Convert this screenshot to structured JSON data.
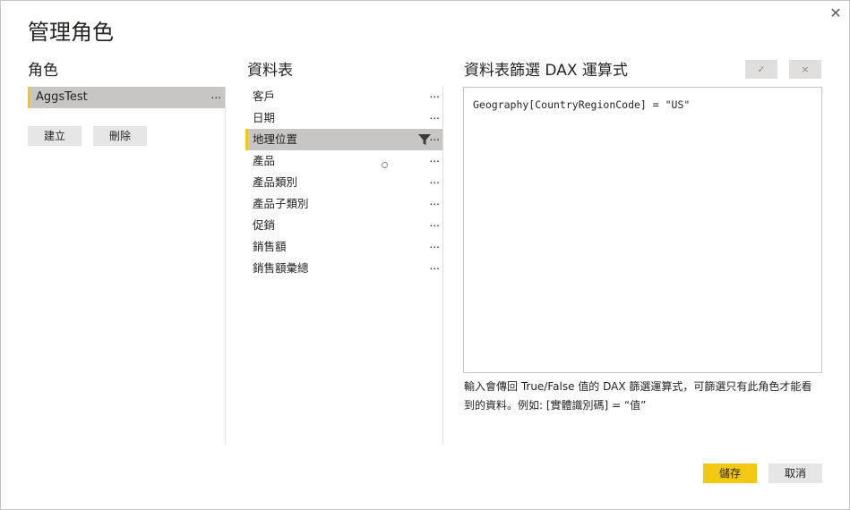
{
  "dialog": {
    "title": "管理角色",
    "close_glyph": "✕"
  },
  "roles": {
    "heading": "角色",
    "items": [
      {
        "name": "AggsTest",
        "more": "..."
      }
    ],
    "create_label": "建立",
    "delete_label": "刪除"
  },
  "tables": {
    "heading": "資料表",
    "items": [
      {
        "name": "客戶",
        "more": "..."
      },
      {
        "name": "日期",
        "more": "..."
      },
      {
        "name": "地理位置",
        "more": "...",
        "selected": true
      },
      {
        "name": "產品",
        "more": "..."
      },
      {
        "name": "產品類別",
        "more": "..."
      },
      {
        "name": "產品子類別",
        "more": "..."
      },
      {
        "name": "促銷",
        "more": "..."
      },
      {
        "name": "銷售額",
        "more": "..."
      },
      {
        "name": "銷售額彙總",
        "more": "..."
      }
    ]
  },
  "expression": {
    "heading": "資料表篩選 DAX 運算式",
    "confirm_glyph": "✓",
    "discard_glyph": "×",
    "code": "Geography[CountryRegionCode] = \"US\"",
    "hint_line1": "輸入會傳回 True/False 值的 DAX 篩選運算式，可篩選只有此角色才能看",
    "hint_line2": "到的資料。例如: [實體識別碼] = “值”"
  },
  "footer": {
    "save_label": "儲存",
    "cancel_label": "取消"
  },
  "colors": {
    "accent": "#f2c811",
    "selection": "#c8c6c4",
    "button": "#e6e6e6"
  }
}
